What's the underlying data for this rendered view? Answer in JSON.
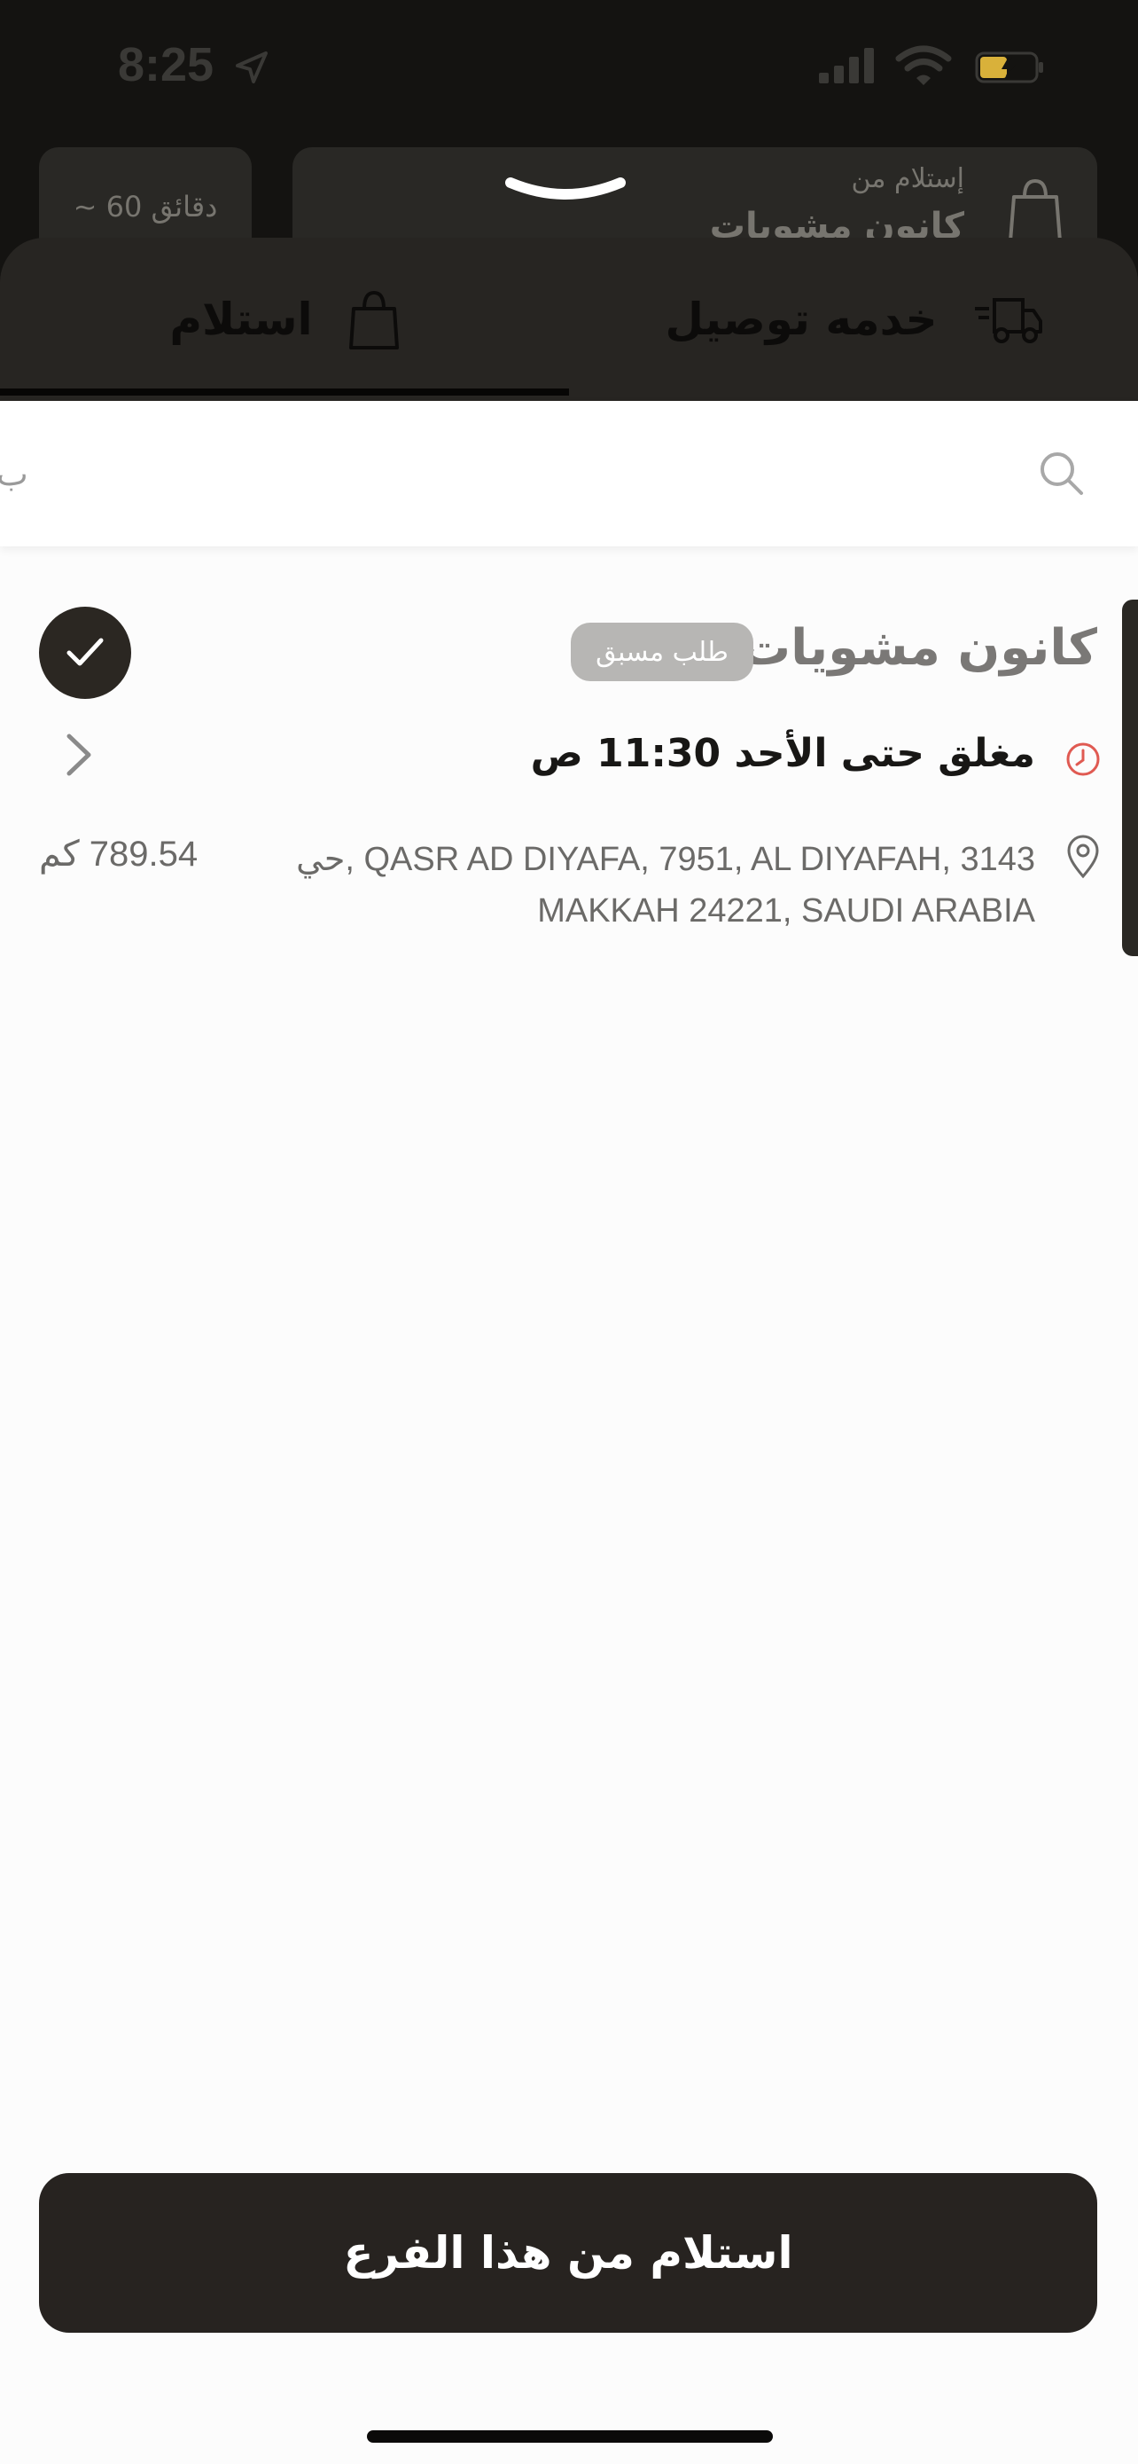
{
  "status_bar": {
    "time": "8:25"
  },
  "background": {
    "eta_label": "~ 60 دقائق",
    "pickup_from_label": "إستلام من",
    "store_name": "كانون مشويات"
  },
  "tabs": [
    {
      "label": "استلام",
      "icon": "bag-icon",
      "selected": true
    },
    {
      "label": "خدمه توصيل",
      "icon": "truck-icon",
      "selected": false
    }
  ],
  "search": {
    "placeholder": "",
    "cut_text": "ب"
  },
  "branch": {
    "name": "كانون مشويات",
    "badge": "طلب مسبق",
    "hours": "مغلق حتى الأحد 11:30 ص",
    "address_line1": "حي, QASR AD DIYAFA, 7951, AL DIYAFAH, 3143",
    "address_line2": "MAKKAH 24221, SAUDI ARABIA",
    "distance": "789.54 كم",
    "selected": true
  },
  "action": {
    "button_label": "استلام من هذا الفرع"
  },
  "colors": {
    "primary": "#272320",
    "closed_clock": "#e05a52",
    "badge_bg": "#b7b6b4"
  }
}
